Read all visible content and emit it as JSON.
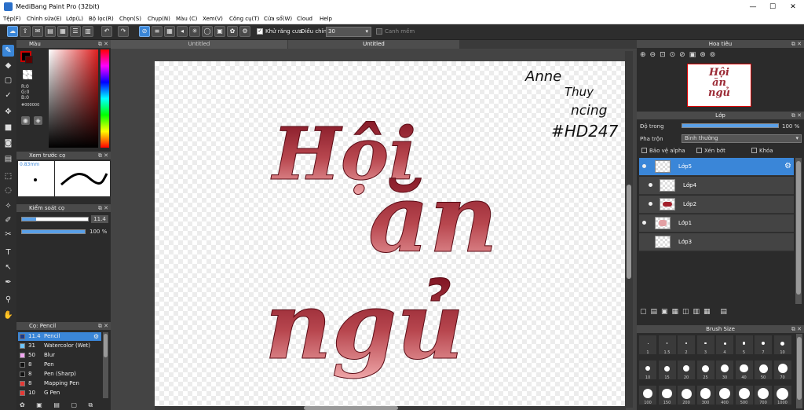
{
  "window": {
    "title": "MediBang Paint Pro (32bit)",
    "minimize": "—",
    "maximize": "☐",
    "close": "✕"
  },
  "menu": [
    "Tệp(F)",
    "Chỉnh sửa(E)",
    "Lớp(L)",
    "Bộ lọc(R)",
    "Chọn(S)",
    "Chụp(N)",
    "Màu (C)",
    "Xem(V)",
    "Công cụ(T)",
    "Cửa sổ(W)",
    "Cloud",
    "Help"
  ],
  "toolbar": {
    "antialias_label": "Khử răng cưa",
    "antialias_checked": true,
    "adjust_label": "Điều chỉnh",
    "adjust_value": "30",
    "edge_label": "Canh mềm",
    "edge_checked": false
  },
  "tabs": [
    "Untitled",
    "Untitled"
  ],
  "color_panel": {
    "title": "Màu",
    "r": "R:0",
    "g": "G:0",
    "b": "B:0",
    "hex": "#000000",
    "foreground": "#000000"
  },
  "brush_preview": {
    "title": "Xem trước cọ",
    "size": "0.83mm"
  },
  "brush_control": {
    "title": "Kiểm soát cọ",
    "size": "11.4",
    "opacity": "100 %",
    "opacity_fraction": 1.0
  },
  "brushes": {
    "title": "Cọ: Pencil",
    "items": [
      {
        "size": "11.4",
        "name": "Pencil",
        "color": "#1e3a8a"
      },
      {
        "size": "31",
        "name": "Watercolor (Wet)",
        "color": "#6ec6ff"
      },
      {
        "size": "50",
        "name": "Blur",
        "color": "#f3a6f3"
      },
      {
        "size": "8",
        "name": "Pen",
        "color": "#111111"
      },
      {
        "size": "8",
        "name": "Pen (Sharp)",
        "color": "#111111"
      },
      {
        "size": "8",
        "name": "Mapping Pen",
        "color": "#e53935"
      },
      {
        "size": "10",
        "name": "G Pen",
        "color": "#e53935"
      }
    ]
  },
  "navigator": {
    "title": "Hoa tiêu"
  },
  "layer_panel": {
    "title": "Lớp",
    "opacity_label": "Độ trong",
    "opacity_value": "100 %",
    "opacity_fraction": 1.0,
    "blend_label": "Pha trộn",
    "blend_value": "Bình thường",
    "protect_alpha": "Bảo vệ alpha",
    "clipping": "Xén bớt",
    "lock": "Khóa",
    "layers": [
      "Lớp5",
      "Lớp4",
      "Lớp2",
      "Lớp1",
      "Lớp3"
    ]
  },
  "brush_size": {
    "title": "Brush Size",
    "row1": [
      "1",
      "1.5",
      "2",
      "3",
      "4",
      "5",
      "7",
      "10"
    ],
    "row2": [
      "10",
      "15",
      "20",
      "25",
      "30",
      "40",
      "50",
      "70"
    ],
    "row3": [
      "100",
      "150",
      "200",
      "300",
      "400",
      "500",
      "700",
      "1000"
    ]
  },
  "artwork": {
    "title_line1": "Hội",
    "title_line2": "ăn",
    "title_line3": "ngủ",
    "signature": [
      "Anne",
      "Thuy",
      "ncing",
      "#HD247"
    ]
  }
}
